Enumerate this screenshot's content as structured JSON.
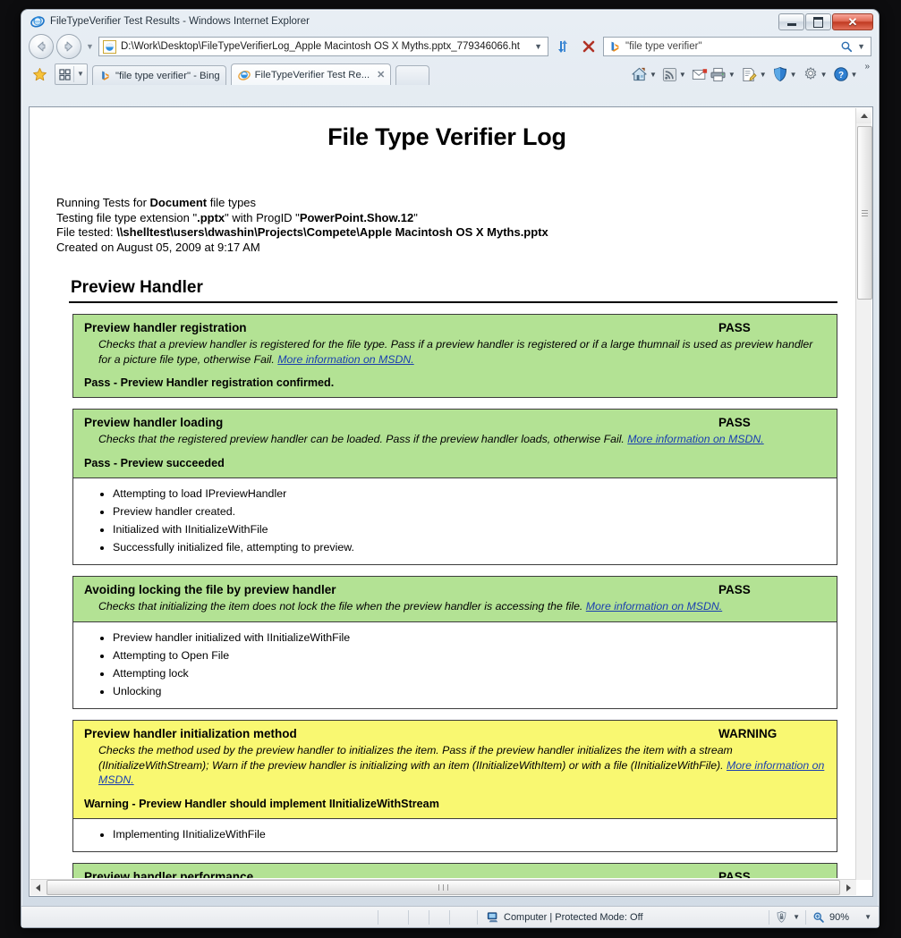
{
  "window": {
    "title": "FileTypeVerifier Test Results - Windows Internet Explorer",
    "minimize_label": "Minimize",
    "maximize_label": "Restore Down",
    "close_label": "Close"
  },
  "navigation": {
    "back_label": "Back",
    "forward_label": "Forward",
    "recent_pages_label": "Recent Pages",
    "address_value": "D:\\Work\\Desktop\\FileTypeVerifierLog_Apple Macintosh OS X Myths.pptx_779346066.ht",
    "address_dropdown_label": "Address dropdown",
    "refresh_label": "Refresh",
    "stop_label": "Stop"
  },
  "search": {
    "value": "\"file type verifier\"",
    "provider": "Bing",
    "go_label": "Search",
    "dropdown_label": "Search options"
  },
  "tabbar": {
    "favorites_label": "Favorites",
    "quick_tabs_label": "Quick Tabs",
    "tab_list_label": "Tab List",
    "new_tab_label": "New Tab",
    "tabs": [
      {
        "label": "\"file type verifier\" - Bing",
        "icon": "bing-icon",
        "active": false,
        "closable": false
      },
      {
        "label": "FileTypeVerifier Test Re...",
        "icon": "ie-icon",
        "active": true,
        "closable": true
      }
    ]
  },
  "commandbar": {
    "items": [
      {
        "name": "home",
        "label": "Home",
        "has_caret": true
      },
      {
        "name": "feeds",
        "label": "Feeds",
        "has_caret": true
      },
      {
        "name": "mail",
        "label": "Read Mail",
        "has_caret": false
      },
      {
        "name": "print",
        "label": "Print",
        "has_caret": true
      },
      {
        "name": "page",
        "label": "Page",
        "has_caret": true
      },
      {
        "name": "safety",
        "label": "Safety",
        "has_caret": true
      },
      {
        "name": "tools",
        "label": "Tools",
        "has_caret": true
      },
      {
        "name": "help",
        "label": "Help",
        "has_caret": true
      }
    ],
    "overflow_label": "»"
  },
  "document": {
    "title": "File Type Verifier Log",
    "meta": {
      "line1_prefix": "Running Tests for ",
      "line1_bold": "Document",
      "line1_suffix": " file types",
      "line2_prefix": "Testing file type extension \"",
      "line2_bold1": ".pptx",
      "line2_mid": "\" with ProgID \"",
      "line2_bold2": "PowerPoint.Show.12",
      "line2_suffix": "\"",
      "line3_prefix": "File tested: ",
      "line3_bold": "\\\\shelltest\\users\\dwashin\\Projects\\Compete\\Apple Macintosh OS X Myths.pptx",
      "line4": "Created on August 05, 2009 at 9:17 AM"
    },
    "section_title": "Preview Handler",
    "link_text": "More information on MSDN.",
    "tests": [
      {
        "name": "Preview handler registration",
        "status": "PASS",
        "state": "pass",
        "desc_before": "Checks that a preview handler is registered for the file type. Pass if a preview handler is registered or if a large thumnail is used as preview handler for a picture file type, otherwise Fail. ",
        "link": "More information on MSDN.",
        "result": "Pass - Preview Handler registration confirmed.",
        "log": []
      },
      {
        "name": "Preview handler loading",
        "status": "PASS",
        "state": "pass",
        "desc_before": "Checks that the registered preview handler can be loaded. Pass if the preview handler loads, otherwise Fail. ",
        "link": "More information on MSDN.",
        "result": "Pass - Preview succeeded",
        "log": [
          "Attempting to load IPreviewHandler",
          "Preview handler created.",
          "Initialized with IInitializeWithFile",
          "Successfully initialized file, attempting to preview."
        ]
      },
      {
        "name": "Avoiding locking the file by preview handler",
        "status": "PASS",
        "state": "pass",
        "desc_before": "Checks that initializing the item does not lock the file when the preview handler is accessing the file. ",
        "link": "More information on MSDN.",
        "result": "",
        "log": [
          "Preview handler initialized with IInitializeWithFile",
          "Attempting to Open File",
          "Attempting lock",
          "Unlocking"
        ]
      },
      {
        "name": "Preview handler initialization method",
        "status": "WARNING",
        "state": "warn",
        "desc_before": "Checks the method used by the preview handler to initializes the item. Pass if the preview handler initializes the item with a stream (IInitializeWithStream); Warn if the preview handler is initializing with an item (IInitializeWithItem) or with a file (IInitializeWithFile). ",
        "link": "More information on MSDN.",
        "result": "Warning - Preview Handler should implement IInitializeWithStream",
        "log": [
          "Implementing IInitializeWithFile"
        ]
      },
      {
        "name": "Preview handler performance",
        "status": "PASS",
        "state": "pass",
        "desc_before": "",
        "link": "",
        "result": "",
        "log": []
      }
    ]
  },
  "statusbar": {
    "zone_text": "Computer | Protected Mode: Off",
    "zone_icon": "computer-icon",
    "privacy_icon": "privacy-report-icon",
    "zoom_level": "90%",
    "zoom_icon": "zoom-icon",
    "zoom_caret": "▼"
  },
  "colors": {
    "pass_bg": "#b3e294",
    "warn_bg": "#f9f871",
    "link": "#1a3fb0"
  }
}
